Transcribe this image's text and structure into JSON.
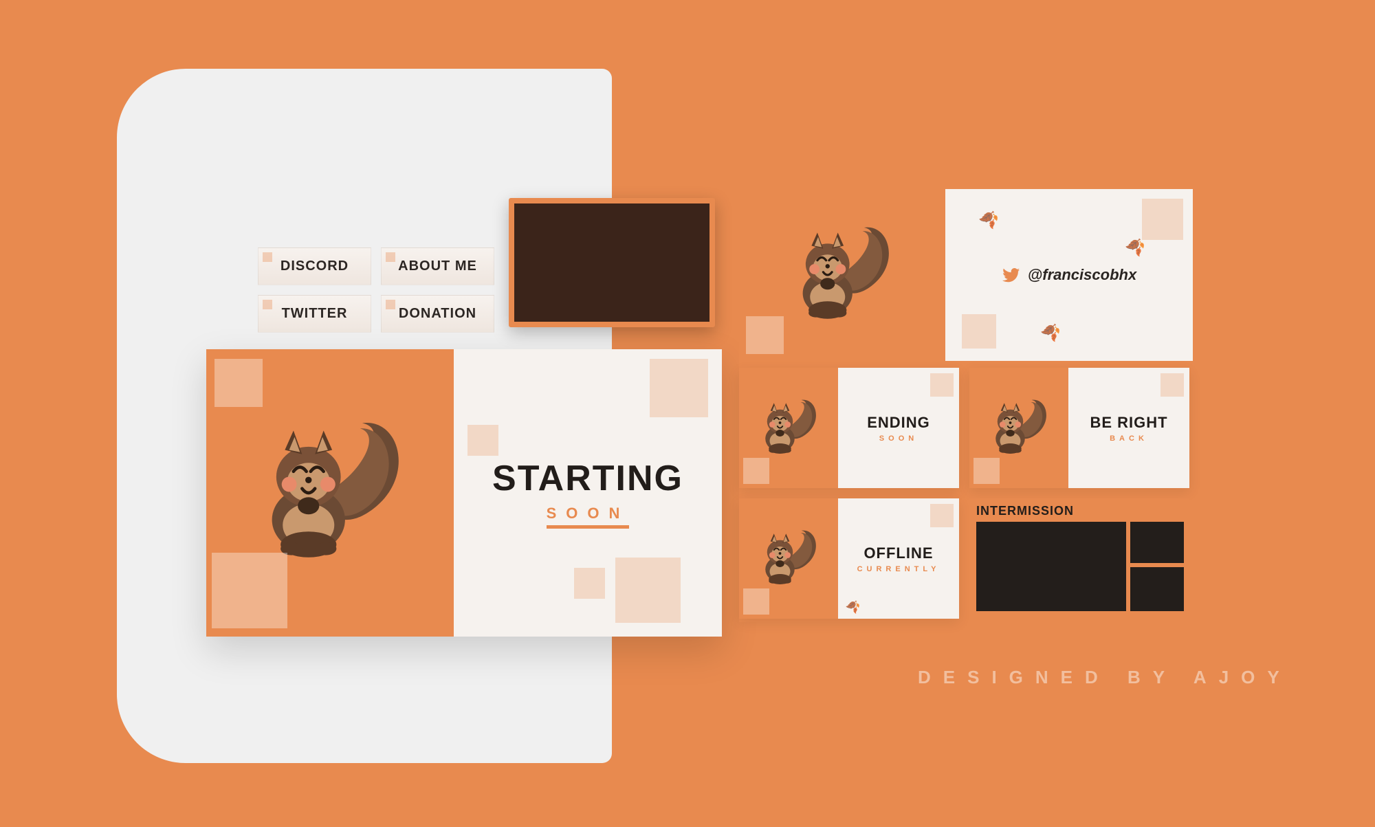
{
  "panels": {
    "discord": "DISCORD",
    "aboutme": "ABOUT ME",
    "twitter": "TWITTER",
    "donation": "DONATION"
  },
  "starting": {
    "title": "STARTING",
    "sub": "SOON"
  },
  "banner": {
    "handle": "@franciscobhx"
  },
  "tiles": {
    "ending": {
      "title": "ENDING",
      "sub": "SOON"
    },
    "beright": {
      "title": "BE RIGHT",
      "sub": "BACK"
    },
    "offline": {
      "title": "OFFLINE",
      "sub": "CURRENTLY"
    }
  },
  "intermission": {
    "label": "INTERMISSION"
  },
  "credit": "DESIGNED BY AJOY",
  "colors": {
    "bg": "#e88a4f",
    "dark": "#3b241a",
    "light": "#f6f2ee"
  }
}
